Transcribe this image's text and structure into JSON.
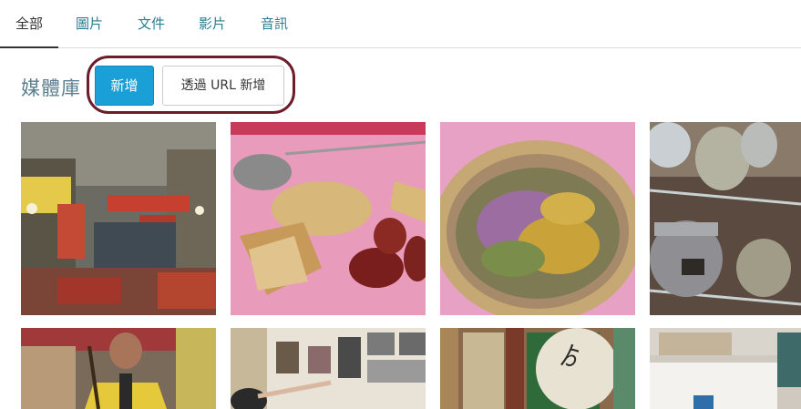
{
  "tabs": [
    {
      "label": "全部",
      "active": true
    },
    {
      "label": "圖片",
      "active": false
    },
    {
      "label": "文件",
      "active": false
    },
    {
      "label": "影片",
      "active": false
    },
    {
      "label": "音訊",
      "active": false
    }
  ],
  "library": {
    "title": "媒體庫",
    "add_label": "新增",
    "add_url_label": "透過 URL 新增"
  },
  "colors": {
    "accent": "#1a9fd6",
    "highlight_ring": "#6d1c2a",
    "tab_link": "#2a7f94"
  },
  "thumbnails": [
    {
      "name": "chinese-herb-shop-street"
    },
    {
      "name": "herbs-on-pink-cloth"
    },
    {
      "name": "dried-flower-tea-basket"
    },
    {
      "name": "herb-jars-on-shelves"
    },
    {
      "name": "man-in-yellow-vest"
    },
    {
      "name": "exhibition-wall-photos"
    },
    {
      "name": "shop-sign-calligraphy"
    },
    {
      "name": "tea-box-package"
    }
  ]
}
